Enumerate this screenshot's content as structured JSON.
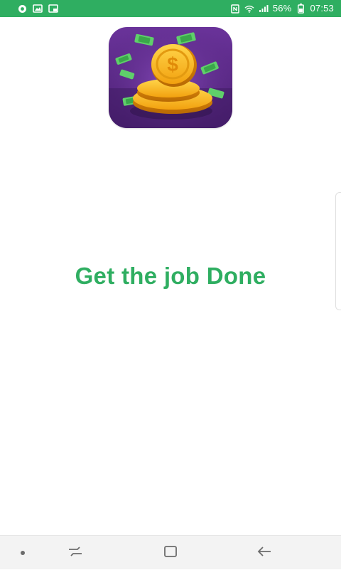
{
  "status_bar": {
    "battery_percent": "56%",
    "time": "07:53",
    "icons": [
      "notification-icon",
      "image-icon",
      "cast-icon",
      "nfc-icon",
      "wifi-icon",
      "signal-icon",
      "battery-icon"
    ]
  },
  "app": {
    "icon": "coins-money-icon",
    "tagline": "Get the job Done"
  },
  "nav_bar": {
    "buttons": [
      "dot-icon",
      "recents-icon",
      "home-icon",
      "back-icon"
    ]
  },
  "colors": {
    "accent": "#2fae61",
    "icon_bg": "#5b2a86",
    "gold": "#f2b21a"
  }
}
